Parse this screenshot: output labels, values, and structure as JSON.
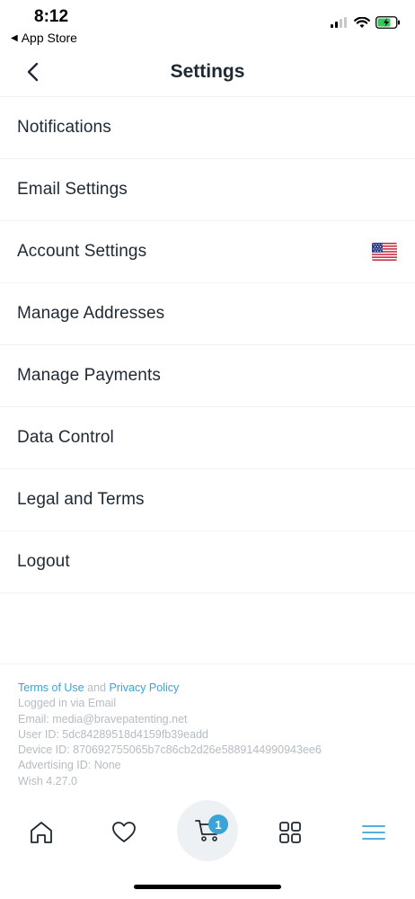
{
  "status_bar": {
    "time": "8:12",
    "back_label": "App Store"
  },
  "header": {
    "title": "Settings"
  },
  "settings": {
    "items": [
      {
        "label": "Notifications"
      },
      {
        "label": "Email Settings"
      },
      {
        "label": "Account Settings",
        "icon": "us-flag-icon"
      },
      {
        "label": "Manage Addresses"
      },
      {
        "label": "Manage Payments"
      },
      {
        "label": "Data Control"
      },
      {
        "label": "Legal and Terms"
      },
      {
        "label": "Logout"
      }
    ]
  },
  "footer": {
    "terms_link": "Terms of Use",
    "and_text": "and",
    "privacy_link": "Privacy Policy",
    "logged_in": "Logged in via Email",
    "email": "Email: media@bravepatenting.net",
    "user_id": "User ID: 5dc84289518d4159fb39eadd",
    "device_id": "Device ID: 870692755065b7c86cb2d26e5889144990943ee6",
    "advertising_id": "Advertising ID: None",
    "version": "Wish 4.27.0"
  },
  "tab_bar": {
    "cart_count": "1",
    "tabs": [
      "home-icon",
      "heart-icon",
      "cart-icon",
      "grid-icon",
      "menu-icon"
    ]
  },
  "colors": {
    "accent": "#3aa3d8",
    "text": "#1f2933",
    "muted": "#b5bcc3"
  }
}
